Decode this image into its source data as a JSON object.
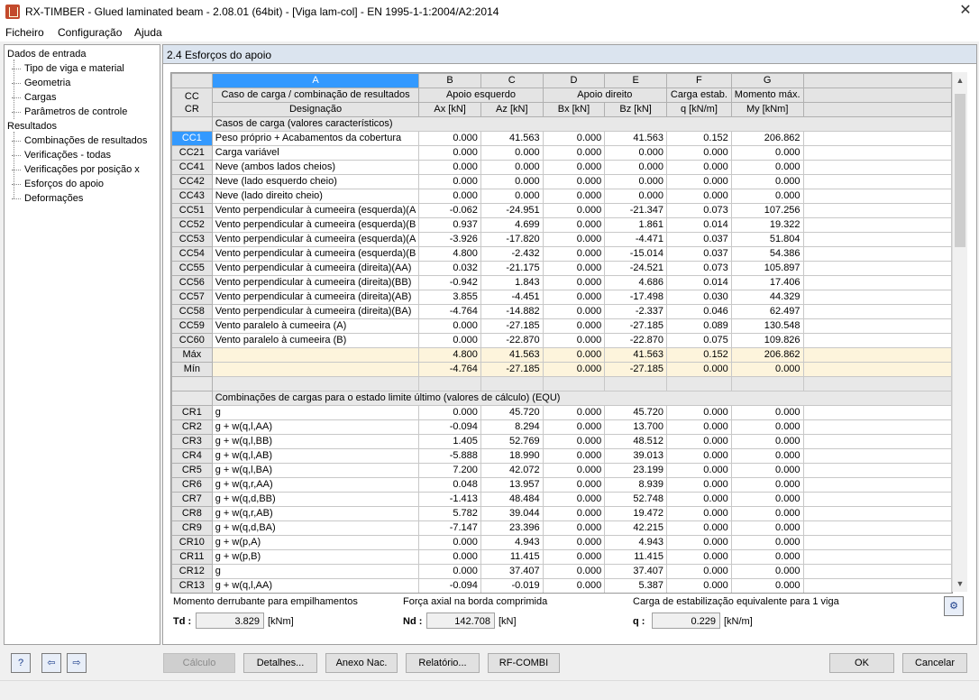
{
  "window": {
    "title": "RX-TIMBER - Glued laminated beam - 2.08.01 (64bit) - [Viga lam-col] - EN 1995-1-1:2004/A2:2014"
  },
  "menu": [
    "Ficheiro",
    "Configuração",
    "Ajuda"
  ],
  "nav": {
    "input_root": "Dados de entrada",
    "input_items": [
      "Tipo de viga e material",
      "Geometria",
      "Cargas",
      "Parâmetros de controle"
    ],
    "results_root": "Resultados",
    "results_items": [
      "Combinações de resultados",
      "Verificações - todas",
      "Verificações por posição x",
      "Esforços do apoio",
      "Deformações"
    ]
  },
  "section": {
    "title": "2.4 Esforços do apoio"
  },
  "table": {
    "col_letters": [
      "A",
      "B",
      "C",
      "D",
      "E",
      "F",
      "G"
    ],
    "rowhead_top": "CC",
    "rowhead_bottom": "CR",
    "group_headers": {
      "a": "Caso de carga / combinação de resultados",
      "bc": "Apoio esquerdo",
      "de": "Apoio direito",
      "f": "Carga estab.",
      "g": "Momento máx."
    },
    "sub_headers": {
      "a": "Designação",
      "b": "Ax [kN]",
      "c": "Az [kN]",
      "d": "Bx [kN]",
      "e": "Bz [kN]",
      "f": "q [kN/m]",
      "g": "My [kNm]"
    },
    "lc_section": "Casos de carga (valores característicos)",
    "lc_rows": [
      {
        "id": "CC1",
        "name": "Peso próprio + Acabamentos da cobertura",
        "b": "0.000",
        "c": "41.563",
        "d": "0.000",
        "e": "41.563",
        "f": "0.152",
        "g": "206.862"
      },
      {
        "id": "CC21",
        "name": "Carga variável",
        "b": "0.000",
        "c": "0.000",
        "d": "0.000",
        "e": "0.000",
        "f": "0.000",
        "g": "0.000"
      },
      {
        "id": "CC41",
        "name": "Neve (ambos lados cheios)",
        "b": "0.000",
        "c": "0.000",
        "d": "0.000",
        "e": "0.000",
        "f": "0.000",
        "g": "0.000"
      },
      {
        "id": "CC42",
        "name": "Neve (lado esquerdo cheio)",
        "b": "0.000",
        "c": "0.000",
        "d": "0.000",
        "e": "0.000",
        "f": "0.000",
        "g": "0.000"
      },
      {
        "id": "CC43",
        "name": "Neve (lado direito cheio)",
        "b": "0.000",
        "c": "0.000",
        "d": "0.000",
        "e": "0.000",
        "f": "0.000",
        "g": "0.000"
      },
      {
        "id": "CC51",
        "name": "Vento perpendicular à cumeeira (esquerda)(A",
        "b": "-0.062",
        "c": "-24.951",
        "d": "0.000",
        "e": "-21.347",
        "f": "0.073",
        "g": "107.256"
      },
      {
        "id": "CC52",
        "name": "Vento perpendicular à cumeeira (esquerda)(B",
        "b": "0.937",
        "c": "4.699",
        "d": "0.000",
        "e": "1.861",
        "f": "0.014",
        "g": "19.322"
      },
      {
        "id": "CC53",
        "name": "Vento perpendicular à cumeeira (esquerda)(A",
        "b": "-3.926",
        "c": "-17.820",
        "d": "0.000",
        "e": "-4.471",
        "f": "0.037",
        "g": "51.804"
      },
      {
        "id": "CC54",
        "name": "Vento perpendicular à cumeeira (esquerda)(B",
        "b": "4.800",
        "c": "-2.432",
        "d": "0.000",
        "e": "-15.014",
        "f": "0.037",
        "g": "54.386"
      },
      {
        "id": "CC55",
        "name": "Vento perpendicular à cumeeira (direita)(AA)",
        "b": "0.032",
        "c": "-21.175",
        "d": "0.000",
        "e": "-24.521",
        "f": "0.073",
        "g": "105.897"
      },
      {
        "id": "CC56",
        "name": "Vento perpendicular à cumeeira (direita)(BB)",
        "b": "-0.942",
        "c": "1.843",
        "d": "0.000",
        "e": "4.686",
        "f": "0.014",
        "g": "17.406"
      },
      {
        "id": "CC57",
        "name": "Vento perpendicular à cumeeira (direita)(AB)",
        "b": "3.855",
        "c": "-4.451",
        "d": "0.000",
        "e": "-17.498",
        "f": "0.030",
        "g": "44.329"
      },
      {
        "id": "CC58",
        "name": "Vento perpendicular à cumeeira (direita)(BA)",
        "b": "-4.764",
        "c": "-14.882",
        "d": "0.000",
        "e": "-2.337",
        "f": "0.046",
        "g": "62.497"
      },
      {
        "id": "CC59",
        "name": "Vento paralelo à cumeeira (A)",
        "b": "0.000",
        "c": "-27.185",
        "d": "0.000",
        "e": "-27.185",
        "f": "0.089",
        "g": "130.548"
      },
      {
        "id": "CC60",
        "name": "Vento paralelo à cumeeira (B)",
        "b": "0.000",
        "c": "-22.870",
        "d": "0.000",
        "e": "-22.870",
        "f": "0.075",
        "g": "109.826"
      }
    ],
    "max_row": {
      "id": "Máx",
      "b": "4.800",
      "c": "41.563",
      "d": "0.000",
      "e": "41.563",
      "f": "0.152",
      "g": "206.862"
    },
    "min_row": {
      "id": "Mín",
      "b": "-4.764",
      "c": "-27.185",
      "d": "0.000",
      "e": "-27.185",
      "f": "0.000",
      "g": "0.000"
    },
    "rc_section": "Combinações de cargas para o estado limite último (valores de cálculo) (EQU)",
    "rc_rows": [
      {
        "id": "CR1",
        "name": "g",
        "b": "0.000",
        "c": "45.720",
        "d": "0.000",
        "e": "45.720",
        "f": "0.000",
        "g": "0.000"
      },
      {
        "id": "CR2",
        "name": "g + w(q,l,AA)",
        "b": "-0.094",
        "c": "8.294",
        "d": "0.000",
        "e": "13.700",
        "f": "0.000",
        "g": "0.000"
      },
      {
        "id": "CR3",
        "name": "g + w(q,l,BB)",
        "b": "1.405",
        "c": "52.769",
        "d": "0.000",
        "e": "48.512",
        "f": "0.000",
        "g": "0.000"
      },
      {
        "id": "CR4",
        "name": "g + w(q,l,AB)",
        "b": "-5.888",
        "c": "18.990",
        "d": "0.000",
        "e": "39.013",
        "f": "0.000",
        "g": "0.000"
      },
      {
        "id": "CR5",
        "name": "g + w(q,l,BA)",
        "b": "7.200",
        "c": "42.072",
        "d": "0.000",
        "e": "23.199",
        "f": "0.000",
        "g": "0.000"
      },
      {
        "id": "CR6",
        "name": "g + w(q,r,AA)",
        "b": "0.048",
        "c": "13.957",
        "d": "0.000",
        "e": "8.939",
        "f": "0.000",
        "g": "0.000"
      },
      {
        "id": "CR7",
        "name": "g + w(q,d,BB)",
        "b": "-1.413",
        "c": "48.484",
        "d": "0.000",
        "e": "52.748",
        "f": "0.000",
        "g": "0.000"
      },
      {
        "id": "CR8",
        "name": "g + w(q,r,AB)",
        "b": "5.782",
        "c": "39.044",
        "d": "0.000",
        "e": "19.472",
        "f": "0.000",
        "g": "0.000"
      },
      {
        "id": "CR9",
        "name": "g + w(q,d,BA)",
        "b": "-7.147",
        "c": "23.396",
        "d": "0.000",
        "e": "42.215",
        "f": "0.000",
        "g": "0.000"
      },
      {
        "id": "CR10",
        "name": "g + w(p,A)",
        "b": "0.000",
        "c": "4.943",
        "d": "0.000",
        "e": "4.943",
        "f": "0.000",
        "g": "0.000"
      },
      {
        "id": "CR11",
        "name": "g + w(p,B)",
        "b": "0.000",
        "c": "11.415",
        "d": "0.000",
        "e": "11.415",
        "f": "0.000",
        "g": "0.000"
      },
      {
        "id": "CR12",
        "name": "g",
        "b": "0.000",
        "c": "37.407",
        "d": "0.000",
        "e": "37.407",
        "f": "0.000",
        "g": "0.000"
      },
      {
        "id": "CR13",
        "name": "g + w(q,l,AA)",
        "b": "-0.094",
        "c": "-0.019",
        "d": "0.000",
        "e": "5.387",
        "f": "0.000",
        "g": "0.000"
      }
    ]
  },
  "bottom_info": {
    "td_label": "Momento derrubante para empilhamentos",
    "td_symbol": "Td :",
    "td_value": "3.829",
    "td_unit": "[kNm]",
    "nd_label": "Força axial na borda comprimida",
    "nd_symbol": "Nd :",
    "nd_value": "142.708",
    "nd_unit": "[kN]",
    "q_label": "Carga de estabilização equivalente para 1 viga",
    "q_symbol": "q :",
    "q_value": "0.229",
    "q_unit": "[kN/m]"
  },
  "buttons": {
    "calc": "Cálculo",
    "details": "Detalhes...",
    "annex": "Anexo Nac.",
    "report": "Relatório...",
    "rfcombi": "RF-COMBI",
    "ok": "OK",
    "cancel": "Cancelar"
  },
  "icons": [
    "help-icon",
    "import-icon",
    "export-icon",
    "settings-icon"
  ]
}
